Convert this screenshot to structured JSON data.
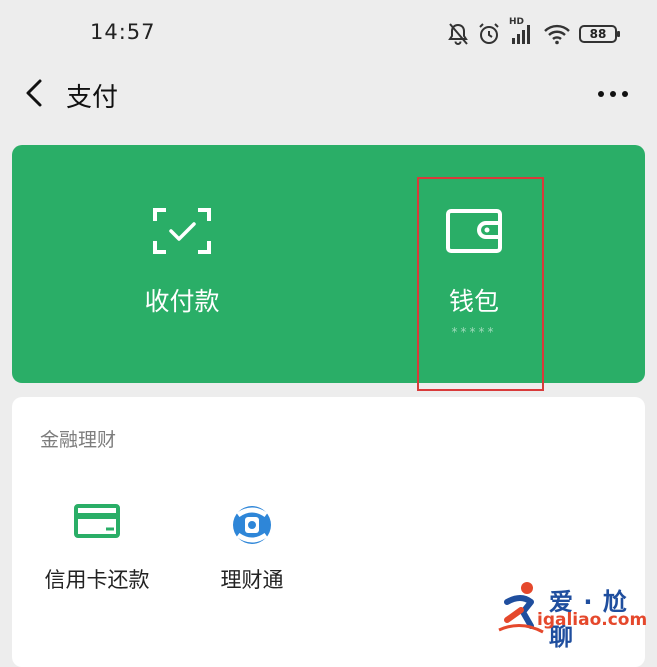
{
  "status_bar": {
    "time": "14:57",
    "network_label": "HD",
    "battery": "88",
    "icons": [
      "bell-off-icon",
      "alarm-clock-icon",
      "signal-icon",
      "wifi-icon",
      "battery-icon"
    ]
  },
  "navbar": {
    "back_icon": "chevron-left-icon",
    "title": "支付",
    "more_icon": "more-horizontal-icon"
  },
  "pay_card": {
    "background": "#2aae67",
    "items": [
      {
        "label": "收付款",
        "icon": "scan-check-icon"
      },
      {
        "label": "钱包",
        "sub": "*****",
        "icon": "wallet-icon"
      }
    ]
  },
  "highlight": {
    "color": "#d83a3a",
    "target": "钱包"
  },
  "finance": {
    "section_title": "金融理财",
    "items": [
      {
        "label": "信用卡还款",
        "icon": "credit-card-icon"
      },
      {
        "label": "理财通",
        "icon": "wealth-icon"
      }
    ]
  },
  "watermark": {
    "brand": "爱 · 尬聊",
    "domain": "igaliao.com"
  }
}
